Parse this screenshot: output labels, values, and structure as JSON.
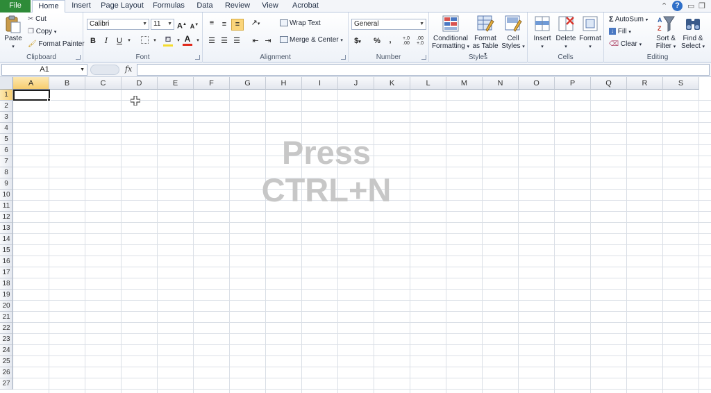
{
  "tabs": [
    {
      "label": "File"
    },
    {
      "label": "Home"
    },
    {
      "label": "Insert"
    },
    {
      "label": "Page Layout"
    },
    {
      "label": "Formulas"
    },
    {
      "label": "Data"
    },
    {
      "label": "Review"
    },
    {
      "label": "View"
    },
    {
      "label": "Acrobat"
    }
  ],
  "window_controls": {
    "help": "?"
  },
  "clipboard": {
    "paste": "Paste",
    "cut": "Cut",
    "copy": "Copy",
    "format_painter": "Format Painter",
    "label": "Clipboard"
  },
  "font": {
    "name": "Calibri",
    "size": "11",
    "bold": "B",
    "italic": "I",
    "underline": "U",
    "grow": "A",
    "shrink": "A",
    "color_letter": "A",
    "label": "Font",
    "font_color": "#e0291c",
    "fill_color": "#f4dc2e"
  },
  "alignment": {
    "wrap_text": "Wrap Text",
    "merge_center": "Merge & Center",
    "label": "Alignment"
  },
  "number": {
    "format": "General",
    "currency": "$",
    "percent": "%",
    "comma": ",",
    "inc_decimal": "+.0 .00",
    "dec_decimal": ".00 +.0",
    "label": "Number"
  },
  "styles": {
    "conditional_formatting": "Conditional Formatting",
    "format_as_table": "Format as Table",
    "cell_styles": "Cell Styles",
    "label": "Styles"
  },
  "cells": {
    "insert": "Insert",
    "delete": "Delete",
    "format": "Format",
    "label": "Cells"
  },
  "editing": {
    "autosum": "AutoSum",
    "fill": "Fill",
    "clear": "Clear",
    "sort_filter": "Sort & Filter",
    "find_select": "Find & Select",
    "label": "Editing"
  },
  "formula_bar": {
    "name_box": "A1",
    "fx": "fx",
    "value": ""
  },
  "sheet": {
    "columns": [
      "A",
      "B",
      "C",
      "D",
      "E",
      "F",
      "G",
      "H",
      "I",
      "J",
      "K",
      "L",
      "M",
      "N",
      "O",
      "P",
      "Q",
      "R",
      "S"
    ],
    "rows": [
      "1",
      "2",
      "3",
      "4",
      "5",
      "6",
      "7",
      "8",
      "9",
      "10",
      "11",
      "12",
      "13",
      "14",
      "15",
      "16",
      "17",
      "18",
      "19",
      "20",
      "21",
      "22",
      "23",
      "24",
      "25",
      "26",
      "27"
    ],
    "selected_cell": "A1"
  },
  "overlay": {
    "line1": "Press",
    "line2": "CTRL+N"
  }
}
